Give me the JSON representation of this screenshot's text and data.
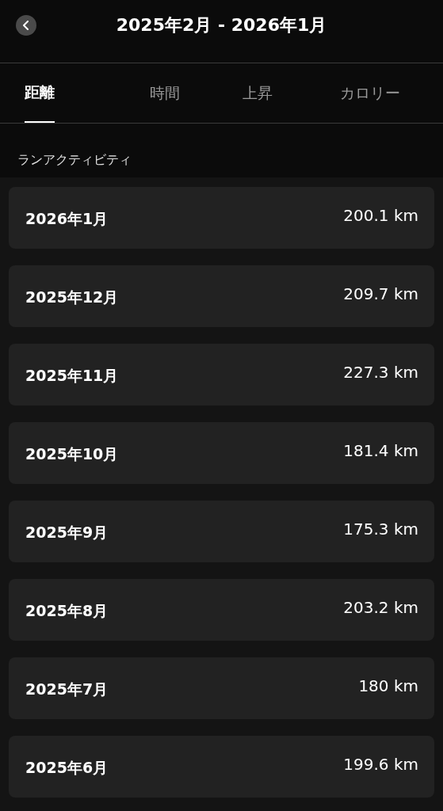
{
  "header": {
    "title": "2025年2月 - 2026年1月"
  },
  "tabs": [
    {
      "label": "距離",
      "selected": true
    },
    {
      "label": "時間",
      "selected": false
    },
    {
      "label": "上昇",
      "selected": false
    },
    {
      "label": "カロリー",
      "selected": false
    }
  ],
  "section": {
    "title": "ランアクティビティ"
  },
  "months": [
    {
      "label": "2026年1月",
      "value": "200.1 km"
    },
    {
      "label": "2025年12月",
      "value": "209.7 km"
    },
    {
      "label": "2025年11月",
      "value": "227.3 km"
    },
    {
      "label": "2025年10月",
      "value": "181.4 km"
    },
    {
      "label": "2025年9月",
      "value": "175.3 km"
    },
    {
      "label": "2025年8月",
      "value": "203.2 km"
    },
    {
      "label": "2025年7月",
      "value": "180 km"
    },
    {
      "label": "2025年6月",
      "value": "199.6 km"
    }
  ]
}
